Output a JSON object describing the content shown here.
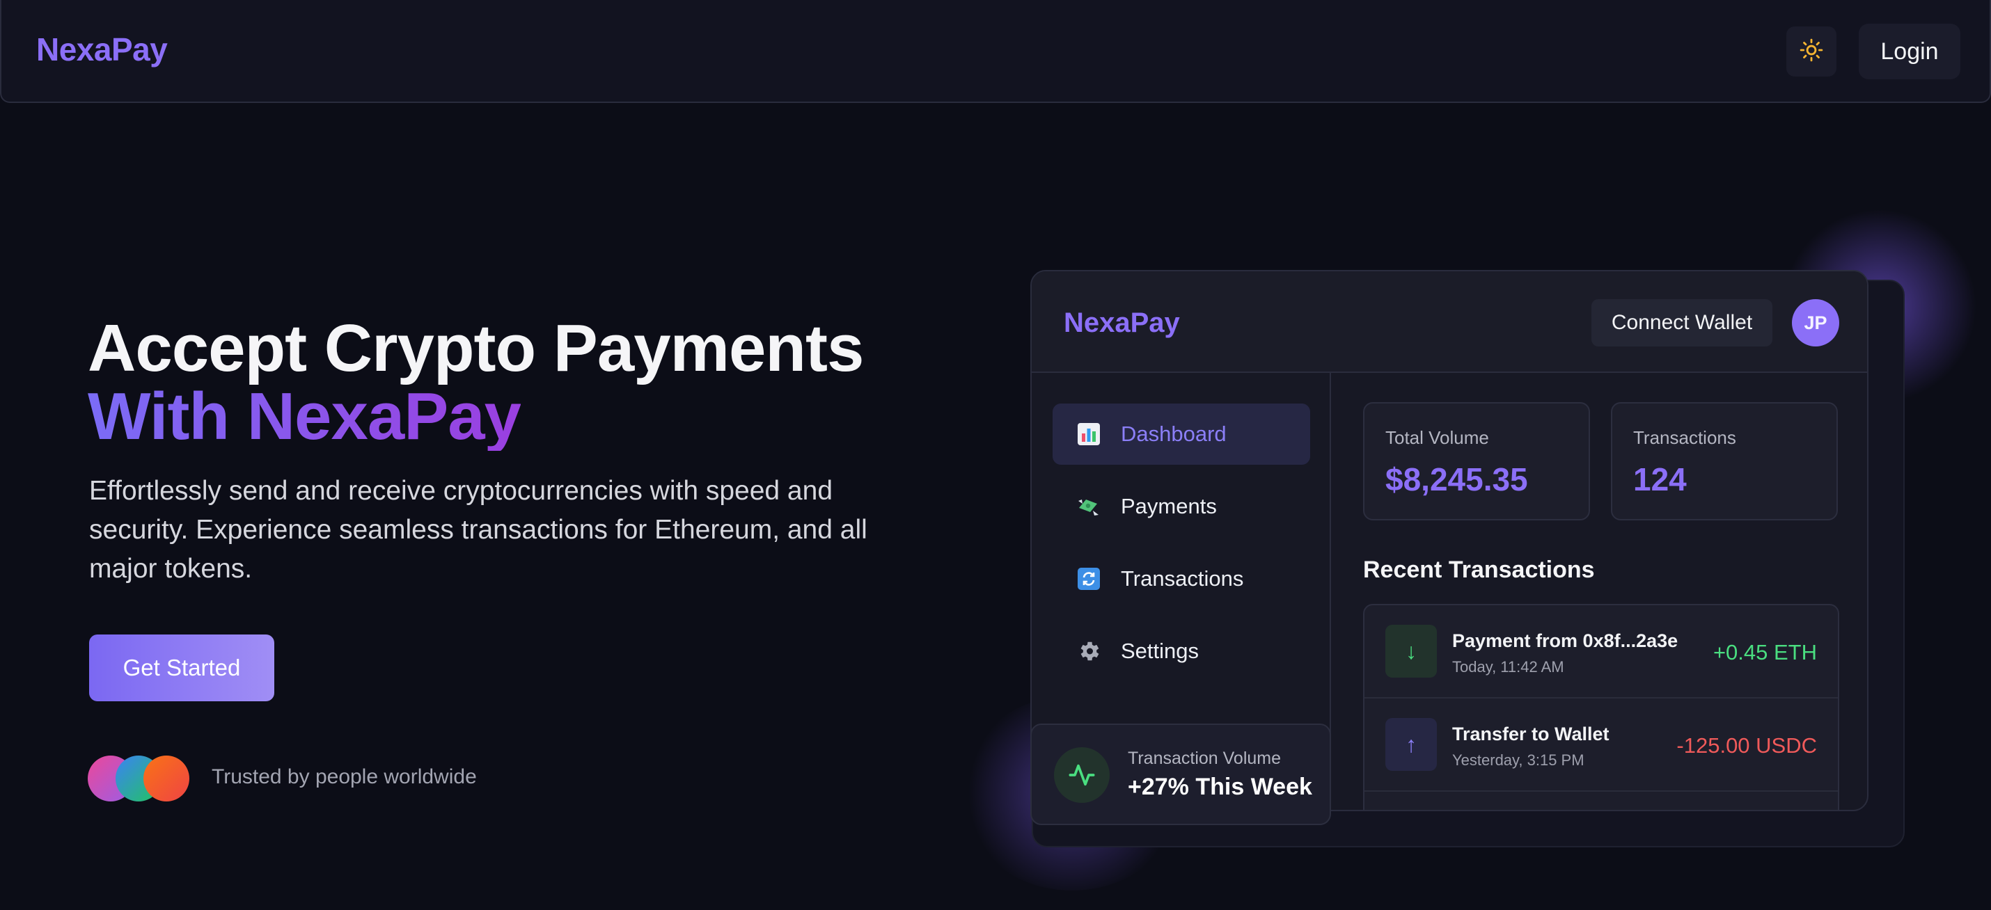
{
  "nav": {
    "brand": "NexaPay",
    "theme_icon": "sun-icon",
    "login_label": "Login"
  },
  "hero": {
    "title_line1": "Accept Crypto Payments",
    "title_line2_a": "With",
    "title_line2_b": "NexaPay",
    "description": "Effortlessly send and receive cryptocurrencies with speed and security. Experience seamless transactions for Ethereum, and all major tokens.",
    "cta_label": "Get Started",
    "trusted_text": "Trusted by people worldwide"
  },
  "dashboard": {
    "brand": "NexaPay",
    "connect_label": "Connect Wallet",
    "avatar_initials": "JP",
    "sidebar": [
      {
        "label": "Dashboard",
        "icon": "bar-chart-icon",
        "active": true
      },
      {
        "label": "Payments",
        "icon": "money-wings-icon",
        "active": false
      },
      {
        "label": "Transactions",
        "icon": "refresh-icon",
        "active": false
      },
      {
        "label": "Settings",
        "icon": "gear-icon",
        "active": false
      }
    ],
    "stats": [
      {
        "label": "Total Volume",
        "value": "$8,245.35"
      },
      {
        "label": "Transactions",
        "value": "124"
      }
    ],
    "recent_title": "Recent Transactions",
    "transactions": [
      {
        "title": "Payment from 0x8f...2a3e",
        "time": "Today, 11:42 AM",
        "amount": "+0.45 ETH",
        "direction": "in",
        "icon": "arrow-down-icon"
      },
      {
        "title": "Transfer to Wallet",
        "time": "Yesterday, 3:15 PM",
        "amount": "-125.00 USDC",
        "direction": "out",
        "icon": "arrow-up-icon"
      }
    ]
  },
  "volume_card": {
    "label": "Transaction Volume",
    "value": "+27% This Week",
    "icon": "activity-icon"
  },
  "colors": {
    "background": "#0c0d17",
    "accent": "#8b6ff7",
    "positive": "#4ade80",
    "negative": "#f05a5a"
  }
}
